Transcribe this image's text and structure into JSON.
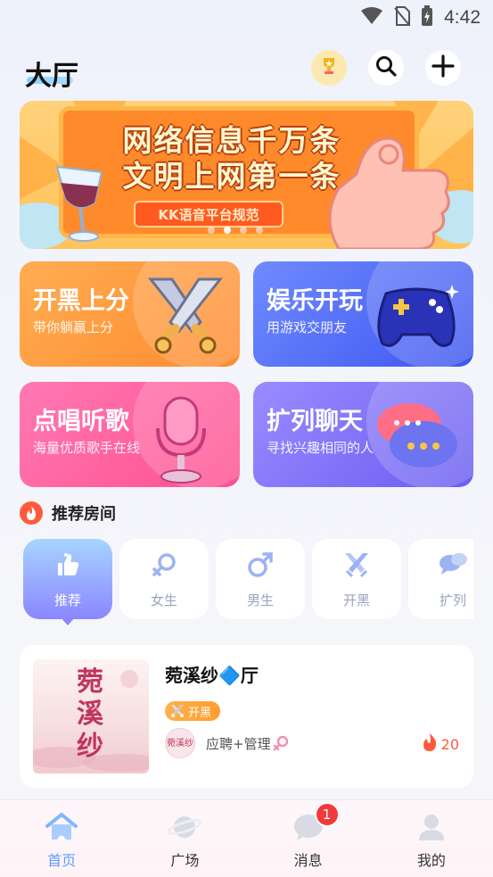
{
  "status_bar": {
    "time": "4:42",
    "icons": [
      "wifi-icon",
      "no-sim-icon",
      "battery-charging-icon"
    ]
  },
  "header": {
    "title": "大厅",
    "buttons": [
      "trophy-icon",
      "search-icon",
      "add-icon"
    ]
  },
  "banner": {
    "line1": "网络信息千万条",
    "line2": "文明上网第一条",
    "tag": "KK语音平台规范",
    "dots": 4,
    "active_dot": 1
  },
  "categories": [
    {
      "title": "开黑上分",
      "subtitle": "带你躺赢上分",
      "color": "#ff9a3c",
      "icon": "swords-icon"
    },
    {
      "title": "娱乐开玩",
      "subtitle": "用游戏交朋友",
      "color": "#4f63f5",
      "icon": "gamepad-icon"
    },
    {
      "title": "点唱听歌",
      "subtitle": "海量优质歌手在线",
      "color": "#ff5f9e",
      "icon": "microphone-icon"
    },
    {
      "title": "扩列聊天",
      "subtitle": "寻找兴趣相同的人",
      "color": "#7d6ff5",
      "icon": "chat-bubble-icon"
    }
  ],
  "recommend": {
    "title": "推荐房间",
    "tabs": [
      {
        "label": "推荐",
        "icon": "thumbs-up-icon",
        "active": true
      },
      {
        "label": "女生",
        "icon": "female-icon",
        "active": false
      },
      {
        "label": "男生",
        "icon": "male-icon",
        "active": false
      },
      {
        "label": "开黑",
        "icon": "crossed-swords-icon",
        "active": false
      },
      {
        "label": "扩列",
        "icon": "chat-icon",
        "active": false
      }
    ]
  },
  "room": {
    "name": "菀溪纱🔷厅",
    "cover_text": "菀溪纱",
    "tag": "开黑",
    "host_avatar_text": "菀溪纱",
    "host": "应聘+管理",
    "heat": "20"
  },
  "bottom_nav": {
    "items": [
      {
        "label": "首页",
        "icon": "home-icon",
        "active": true
      },
      {
        "label": "广场",
        "icon": "planet-icon",
        "active": false
      },
      {
        "label": "消息",
        "icon": "message-icon",
        "active": false,
        "badge": "1"
      },
      {
        "label": "我的",
        "icon": "profile-icon",
        "active": false
      }
    ]
  },
  "colors": {
    "accent": "#5b9cff",
    "fire": "#ff5a3c",
    "badge": "#f33a3a"
  }
}
